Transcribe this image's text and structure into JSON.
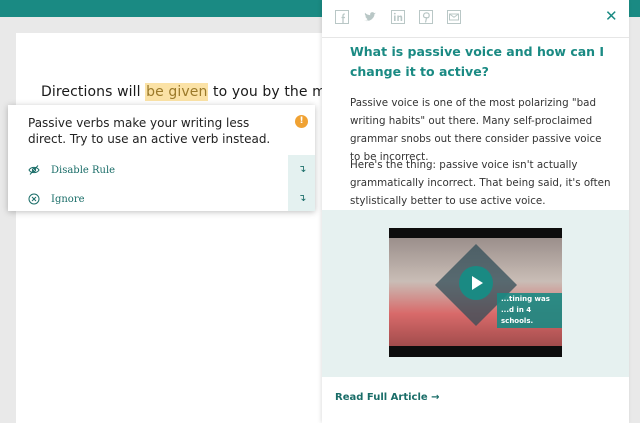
{
  "colors": {
    "accent": "#1a8a83",
    "highlight": "#fbe2a6",
    "warning": "#f0a233"
  },
  "editor": {
    "text_before": "Directions will ",
    "highlight": "be given",
    "text_after": " to you by the manag"
  },
  "suggestion": {
    "message": "Passive verbs make your writing less direct. Try to use an active verb instead.",
    "badge": "!",
    "badge_icon": "info-icon",
    "actions": [
      {
        "label": "Disable Rule",
        "icon": "eye-slash-icon"
      },
      {
        "label": "Ignore",
        "icon": "x-circle-icon"
      }
    ],
    "action_arrow": "↴"
  },
  "panel": {
    "share_icons": [
      "facebook-icon",
      "twitter-icon",
      "linkedin-icon",
      "pinterest-icon",
      "email-icon"
    ],
    "close_glyph": "✕",
    "title": "What is passive voice and how can I change it to active?",
    "paragraphs": [
      "Passive voice is one of the most polarizing \"bad writing habits\" out there. Many self-proclaimed grammar snobs out there consider passive voice to be incorrect.",
      "Here's the thing: passive voice isn't actually grammatically incorrect. That being said, it's often stylistically better to use active voice."
    ],
    "video_caption": "...tining was ...d in 4 schools.",
    "read_more": "Read Full Article →"
  }
}
